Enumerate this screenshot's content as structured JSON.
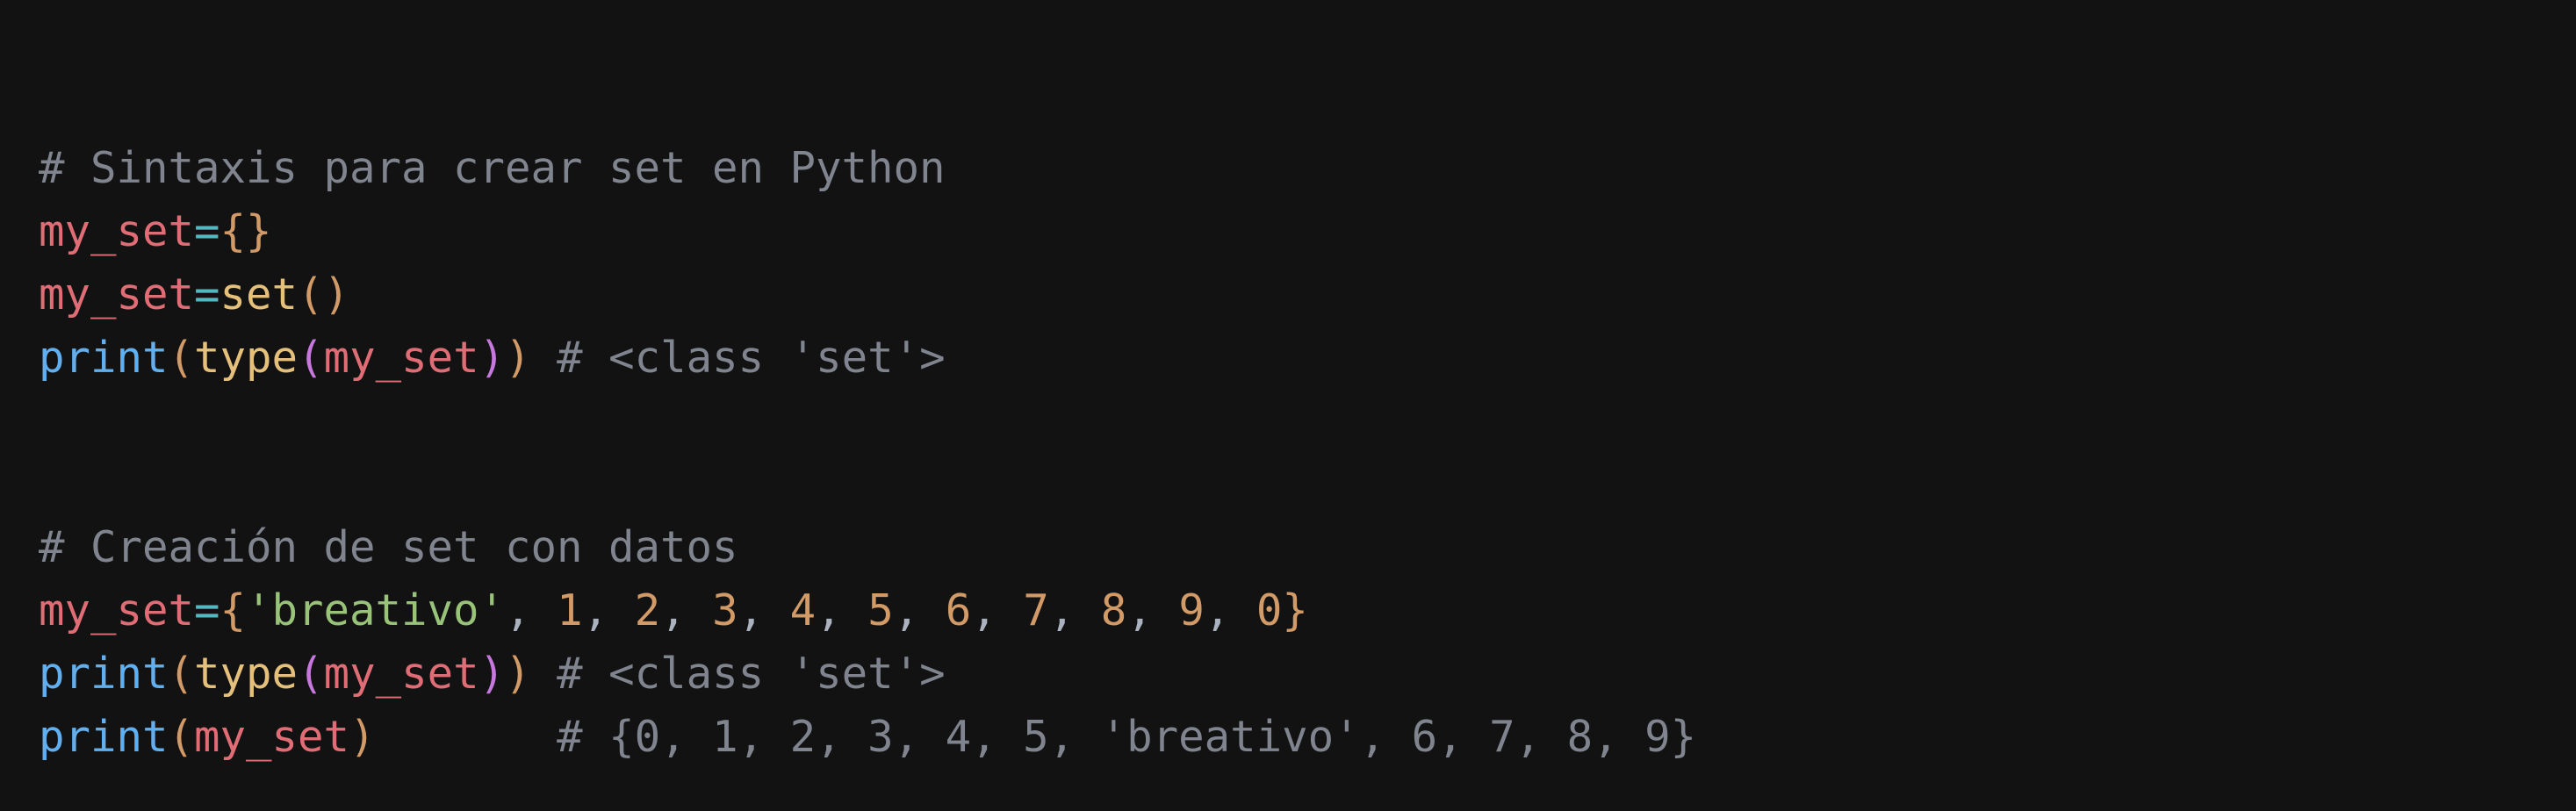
{
  "colors": {
    "background": "#121212",
    "comment": "#7f848e",
    "variable": "#e06c75",
    "operator": "#56b6c2",
    "bracket": "#d19a66",
    "function": "#61afef",
    "builtin": "#e5c07b",
    "inner_paren": "#c678dd",
    "string": "#98c379",
    "number": "#d19a66",
    "punct": "#abb2bf"
  },
  "code": {
    "lines": [
      {
        "blank": true,
        "tokens": []
      },
      {
        "tokens": [
          {
            "text": "# Sintaxis para crear set en Python",
            "kind": "comment"
          }
        ]
      },
      {
        "tokens": [
          {
            "text": "my_set",
            "kind": "variable"
          },
          {
            "text": "=",
            "kind": "operator"
          },
          {
            "text": "{}",
            "kind": "bracket"
          }
        ]
      },
      {
        "tokens": [
          {
            "text": "my_set",
            "kind": "variable"
          },
          {
            "text": "=",
            "kind": "operator"
          },
          {
            "text": "set",
            "kind": "builtin"
          },
          {
            "text": "()",
            "kind": "bracket"
          }
        ]
      },
      {
        "tokens": [
          {
            "text": "print",
            "kind": "function"
          },
          {
            "text": "(",
            "kind": "bracket"
          },
          {
            "text": "type",
            "kind": "builtin"
          },
          {
            "text": "(",
            "kind": "inner_paren"
          },
          {
            "text": "my_set",
            "kind": "variable"
          },
          {
            "text": ")",
            "kind": "inner_paren"
          },
          {
            "text": ")",
            "kind": "bracket"
          },
          {
            "text": " # <class 'set'>",
            "kind": "comment"
          }
        ]
      },
      {
        "blank": true,
        "tokens": []
      },
      {
        "blank": true,
        "tokens": []
      },
      {
        "tokens": [
          {
            "text": "# Creación de set con datos",
            "kind": "comment"
          }
        ]
      },
      {
        "tokens": [
          {
            "text": "my_set",
            "kind": "variable"
          },
          {
            "text": "=",
            "kind": "operator"
          },
          {
            "text": "{",
            "kind": "bracket"
          },
          {
            "text": "'breativo'",
            "kind": "string"
          },
          {
            "text": ", ",
            "kind": "punct"
          },
          {
            "text": "1",
            "kind": "number"
          },
          {
            "text": ", ",
            "kind": "punct"
          },
          {
            "text": "2",
            "kind": "number"
          },
          {
            "text": ", ",
            "kind": "punct"
          },
          {
            "text": "3",
            "kind": "number"
          },
          {
            "text": ", ",
            "kind": "punct"
          },
          {
            "text": "4",
            "kind": "number"
          },
          {
            "text": ", ",
            "kind": "punct"
          },
          {
            "text": "5",
            "kind": "number"
          },
          {
            "text": ", ",
            "kind": "punct"
          },
          {
            "text": "6",
            "kind": "number"
          },
          {
            "text": ", ",
            "kind": "punct"
          },
          {
            "text": "7",
            "kind": "number"
          },
          {
            "text": ", ",
            "kind": "punct"
          },
          {
            "text": "8",
            "kind": "number"
          },
          {
            "text": ", ",
            "kind": "punct"
          },
          {
            "text": "9",
            "kind": "number"
          },
          {
            "text": ", ",
            "kind": "punct"
          },
          {
            "text": "0",
            "kind": "number"
          },
          {
            "text": "}",
            "kind": "bracket"
          }
        ]
      },
      {
        "tokens": [
          {
            "text": "print",
            "kind": "function"
          },
          {
            "text": "(",
            "kind": "bracket"
          },
          {
            "text": "type",
            "kind": "builtin"
          },
          {
            "text": "(",
            "kind": "inner_paren"
          },
          {
            "text": "my_set",
            "kind": "variable"
          },
          {
            "text": ")",
            "kind": "inner_paren"
          },
          {
            "text": ")",
            "kind": "bracket"
          },
          {
            "text": " # <class 'set'>",
            "kind": "comment"
          }
        ]
      },
      {
        "tokens": [
          {
            "text": "print",
            "kind": "function"
          },
          {
            "text": "(",
            "kind": "bracket"
          },
          {
            "text": "my_set",
            "kind": "variable"
          },
          {
            "text": ")",
            "kind": "bracket"
          },
          {
            "text": "       # {0, 1, 2, 3, 4, 5, 'breativo', 6, 7, 8, 9}",
            "kind": "comment"
          }
        ]
      }
    ]
  }
}
